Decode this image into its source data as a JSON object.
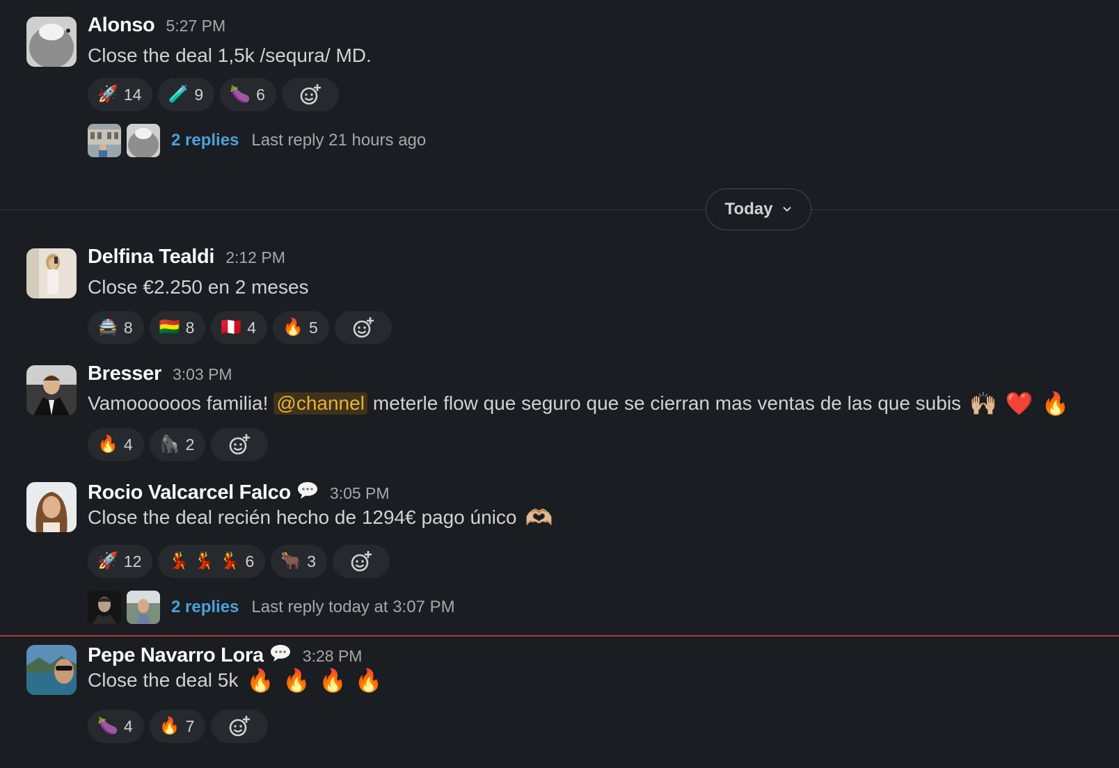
{
  "day_divider": {
    "label": "Today"
  },
  "messages": [
    {
      "author": "Alonso",
      "time": "5:27 PM",
      "text": "Close the deal 1,5k /sequra/ MD.",
      "reactions": [
        {
          "emoji": "🚀",
          "count": "14"
        },
        {
          "emoji": "🧪",
          "count": "9"
        },
        {
          "emoji": "🍆",
          "count": "6"
        }
      ],
      "thread": {
        "replies": "2 replies",
        "last_reply": "Last reply 21 hours ago"
      }
    },
    {
      "author": "Delfina Tealdi",
      "time": "2:12 PM",
      "text": "Close €2.250 en 2 meses",
      "reactions": [
        {
          "emoji": "🚔",
          "count": "8"
        },
        {
          "emoji": "🇧🇴",
          "count": "8"
        },
        {
          "emoji": "🇵🇪",
          "count": "4"
        },
        {
          "emoji": "🔥",
          "count": "5"
        }
      ]
    },
    {
      "author": "Bresser",
      "time": "3:03 PM",
      "text_before": "Vamoooooos familia!",
      "mention": "@channel",
      "text_after": "meterle flow que seguro que se cierran mas ventas de las que subis",
      "inline_emojis": [
        "🙌🏼",
        "❤️",
        "🔥"
      ],
      "reactions": [
        {
          "emoji": "🔥",
          "count": "4"
        },
        {
          "emoji": "🦍",
          "count": "2"
        }
      ]
    },
    {
      "author": "Rocio Valcarcel Falco",
      "time": "3:05 PM",
      "text": "Close the deal recién hecho de 1294€ pago único",
      "inline_emojis": [
        "🫶🏼"
      ],
      "reactions": [
        {
          "emoji": "🚀",
          "count": "12"
        },
        {
          "emoji": "💃 💃 💃",
          "count": "6"
        },
        {
          "emoji": "🐂",
          "count": "3"
        }
      ],
      "thread": {
        "replies": "2 replies",
        "last_reply": "Last reply today at 3:07 PM"
      }
    },
    {
      "author": "Pepe Navarro Lora",
      "time": "3:28 PM",
      "text": "Close the deal 5k",
      "inline_emojis": [
        "🔥",
        "🔥",
        "🔥",
        "🔥"
      ],
      "reactions": [
        {
          "emoji": "🍆",
          "count": "4"
        },
        {
          "emoji": "🔥",
          "count": "7"
        }
      ]
    }
  ],
  "icons": {
    "add_reaction": "add-reaction-icon",
    "chevron": "chevron-down-icon",
    "status": "speech-bubble-icon"
  },
  "colors": {
    "background": "#1a1d21",
    "pill": "#26292e",
    "link": "#4ba1db",
    "mention_text": "#e8b23a",
    "new_messages_line": "#b23a3a"
  }
}
